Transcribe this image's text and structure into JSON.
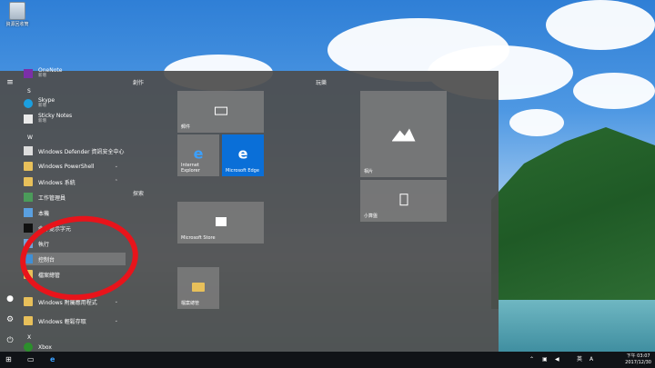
{
  "desktop": {
    "recycle_bin_label": "資源回收筒"
  },
  "start_menu": {
    "app_list": {
      "partial_top": {
        "name": "OneNote",
        "sub": "新增"
      },
      "section_s": "S",
      "skype": {
        "name": "Skype",
        "sub": "新增"
      },
      "sticky": {
        "name": "Sticky Notes",
        "sub": "新增"
      },
      "section_w": "W",
      "defender": "Windows Defender 資訊安全中心",
      "powershell": "Windows PowerShell",
      "system_folder": "Windows 系統",
      "task_manager": "工作管理員",
      "this_pc": "本機",
      "cmd_partial": "命令提示字元",
      "run": "執行",
      "control_panel": "控制台",
      "file_explorer": "檔案總管",
      "accessories": "Windows 附屬應用程式",
      "ease": "Windows 輕鬆存取",
      "section_x": "X",
      "xbox": "Xbox"
    },
    "groups": {
      "create": "創作",
      "play": "玩樂",
      "explore": "探索"
    },
    "tiles": {
      "mail": "郵件",
      "ie": "Internet Explorer",
      "edge": "Microsoft Edge",
      "photos": "相片",
      "calculator": "小算盤",
      "store": "Microsoft Store",
      "explorer": "檔案總管"
    }
  },
  "taskbar": {
    "ime": "英",
    "ime2": "A",
    "time": "下午 03:07",
    "date": "2017/12/30"
  },
  "colors": {
    "edge_tile": "#0a6fd8",
    "annotation_red": "#e8141b"
  }
}
